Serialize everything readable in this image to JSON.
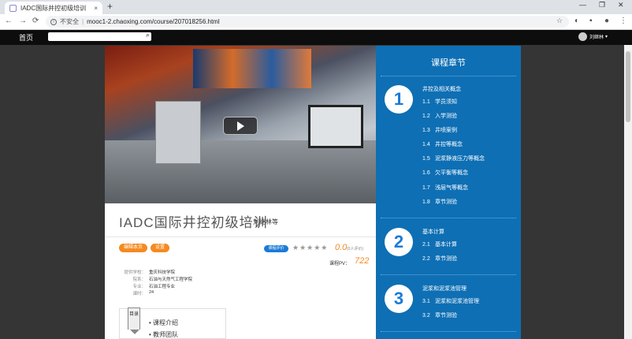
{
  "browser": {
    "tab_title": "IADC国际井控初级培训",
    "tab_close": "×",
    "new_tab": "+",
    "security_label": "不安全",
    "url": "mooc1-2.chaoxing.com/course/207018256.html",
    "omni_separator": "|"
  },
  "site": {
    "home": "首页",
    "user_name": "刘继林",
    "user_caret": "▾"
  },
  "course": {
    "title": "IADC国际井控初级培训",
    "teacher": "刘继林等",
    "edit_button": "编辑本页",
    "settings_button": "设置",
    "rating_badge": "课程评价",
    "stars": "★★★★★",
    "score": "0.0",
    "reviews": "(0人评价)",
    "pv_label": "课程PV：",
    "pv_value": "722",
    "meta": [
      {
        "label": "提供学校：",
        "value": "重庆科技学院"
      },
      {
        "label": "院系：",
        "value": "石油与天然气工程学院"
      },
      {
        "label": "专业：",
        "value": "石油工程专业"
      },
      {
        "label": "课时：",
        "value": "24"
      }
    ],
    "toc_tag": "目录",
    "toc_items": [
      "• 课程介绍",
      "• 教师团队"
    ]
  },
  "chapters": {
    "title": "课程章节",
    "groups": [
      {
        "number": "1",
        "title": "井控及相关概念",
        "items": [
          {
            "num": "1.1",
            "label": "学员须知"
          },
          {
            "num": "1.2",
            "label": "入学测验"
          },
          {
            "num": "1.3",
            "label": "井喷案例"
          },
          {
            "num": "1.4",
            "label": "井控等概念"
          },
          {
            "num": "1.5",
            "label": "泥浆静液压力等概念"
          },
          {
            "num": "1.6",
            "label": "欠平衡等概念"
          },
          {
            "num": "1.7",
            "label": "浅层气等概念"
          },
          {
            "num": "1.8",
            "label": "章节测验"
          }
        ]
      },
      {
        "number": "2",
        "title": "基本计算",
        "items": [
          {
            "num": "2.1",
            "label": "基本计算"
          },
          {
            "num": "2.2",
            "label": "章节测验"
          }
        ]
      },
      {
        "number": "3",
        "title": "泥浆和泥浆池管理",
        "items": [
          {
            "num": "3.1",
            "label": "泥浆和泥浆池管理"
          },
          {
            "num": "3.2",
            "label": "章节测验"
          }
        ]
      }
    ]
  }
}
